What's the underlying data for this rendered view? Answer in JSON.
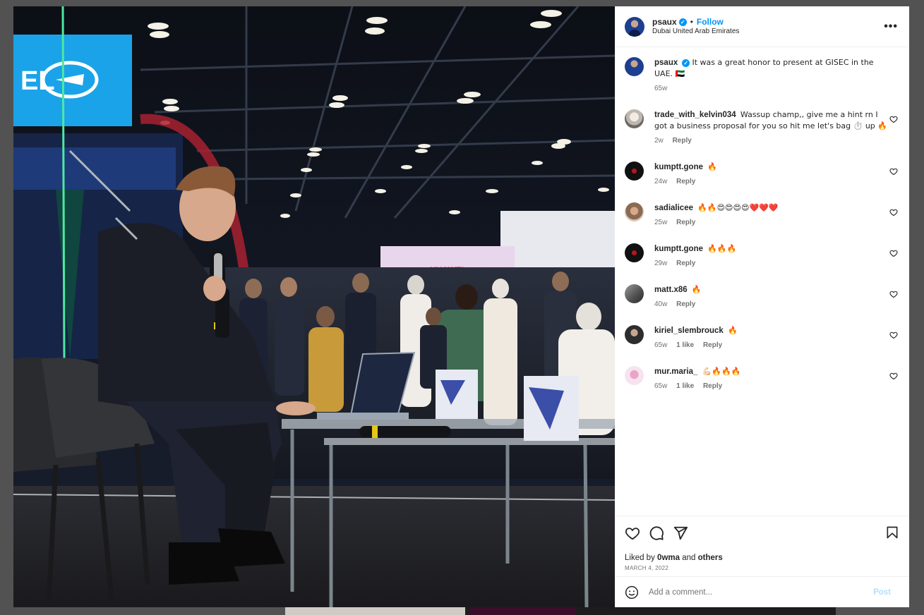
{
  "post": {
    "username": "psaux",
    "verified_mark": "✓",
    "separator": "•",
    "follow_label": "Follow",
    "location": "Dubai United Arab Emirates",
    "more_label": "•••",
    "caption": {
      "username": "psaux",
      "text": "It was a great honor to present at GISEC in the UAE. 🇦🇪",
      "time": "65w"
    },
    "photo": {
      "sign_text": "EL",
      "booth_text": "HUAWEI"
    }
  },
  "comments": [
    {
      "username": "trade_with_kelvin034",
      "text": "Wassup champ,, give me a hint rn I got a business proposal for you so hit me let's bag ⏱️ up 🔥",
      "time": "2w",
      "likes": "",
      "reply": "Reply"
    },
    {
      "username": "kumptt.gone",
      "text": "🔥",
      "time": "24w",
      "likes": "",
      "reply": "Reply"
    },
    {
      "username": "sadialicee",
      "text": "🔥🔥😍😍😍😍❤️❤️❤️",
      "time": "25w",
      "likes": "",
      "reply": "Reply"
    },
    {
      "username": "kumptt.gone",
      "text": "🔥🔥🔥",
      "time": "29w",
      "likes": "",
      "reply": "Reply"
    },
    {
      "username": "matt.x86",
      "text": "🔥",
      "time": "40w",
      "likes": "",
      "reply": "Reply"
    },
    {
      "username": "kiriel_slembrouck",
      "text": "🔥",
      "time": "65w",
      "likes": "1 like",
      "reply": "Reply"
    },
    {
      "username": "mur.maria_",
      "text": "💪🏻🔥🔥🔥",
      "time": "65w",
      "likes": "1 like",
      "reply": "Reply"
    }
  ],
  "actions": {
    "liked_prefix": "Liked by",
    "liked_user": "0wma",
    "liked_and": "and",
    "liked_others": "others",
    "date": "MARCH 4, 2022"
  },
  "add_comment": {
    "placeholder": "Add a comment...",
    "post_label": "Post"
  },
  "icons": [
    "heart-icon",
    "comment-icon",
    "share-icon",
    "bookmark-icon",
    "emoji-icon",
    "more-icon",
    "verified-icon"
  ],
  "colors": {
    "accent": "#0095f6",
    "post_disabled": "#b2dffc",
    "text": "#262626",
    "muted": "#737373"
  }
}
